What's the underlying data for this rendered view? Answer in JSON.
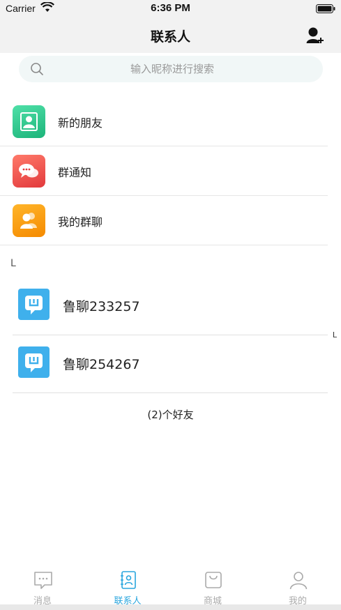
{
  "status_bar": {
    "carrier": "Carrier",
    "time": "6:36 PM"
  },
  "nav": {
    "title": "联系人"
  },
  "search": {
    "placeholder": "输入昵称进行搜索"
  },
  "menu_items": [
    {
      "label": "新的朋友",
      "icon": "new-friend-icon",
      "color": "#2cc98c"
    },
    {
      "label": "群通知",
      "icon": "chat-bubbles-icon",
      "color": "#ef5350"
    },
    {
      "label": "我的群聊",
      "icon": "group-users-icon",
      "color": "#f9a01b"
    }
  ],
  "section_letter": "L",
  "index_letters": [
    "L"
  ],
  "contacts": [
    {
      "name": "鲁聊233257",
      "avatar": "app-logo-icon"
    },
    {
      "name": "鲁聊254267",
      "avatar": "app-logo-icon"
    }
  ],
  "friend_count": "(2)个好友",
  "tabs": [
    {
      "label": "消息",
      "icon": "message-icon",
      "active": false
    },
    {
      "label": "联系人",
      "icon": "contacts-icon",
      "active": true
    },
    {
      "label": "商城",
      "icon": "shopping-bag-icon",
      "active": false
    },
    {
      "label": "我的",
      "icon": "profile-icon",
      "active": false
    }
  ],
  "colors": {
    "accent": "#2aa6de",
    "inactive_tab": "#aaaaaa",
    "avatar_blue": "#3fb0ec"
  }
}
